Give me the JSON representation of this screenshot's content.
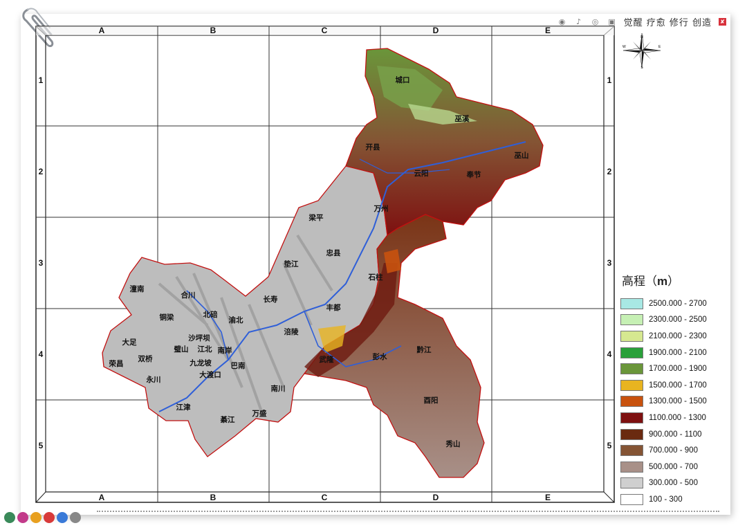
{
  "toolbar": {
    "icons": [
      "wechat-icon",
      "tiktok-icon",
      "weibo-icon",
      "tv-icon"
    ],
    "tagline": "觉醒 疗愈 修行 创造"
  },
  "grid": {
    "columns": [
      "A",
      "B",
      "C",
      "D",
      "E"
    ],
    "rows": [
      "1",
      "2",
      "3",
      "4",
      "5"
    ]
  },
  "compass": {
    "n": "N",
    "s": "S",
    "e": "E",
    "w": "W"
  },
  "places": [
    {
      "name": "城口"
    },
    {
      "name": "巫溪"
    },
    {
      "name": "开县"
    },
    {
      "name": "云阳"
    },
    {
      "name": "奉节"
    },
    {
      "name": "巫山"
    },
    {
      "name": "万州"
    },
    {
      "name": "梁平"
    },
    {
      "name": "忠县"
    },
    {
      "name": "垫江"
    },
    {
      "name": "石柱"
    },
    {
      "name": "潼南"
    },
    {
      "name": "合川"
    },
    {
      "name": "长寿"
    },
    {
      "name": "丰都"
    },
    {
      "name": "铜梁"
    },
    {
      "name": "北碚"
    },
    {
      "name": "渝北"
    },
    {
      "name": "大足"
    },
    {
      "name": "沙坪坝"
    },
    {
      "name": "江北"
    },
    {
      "name": "涪陵"
    },
    {
      "name": "双桥"
    },
    {
      "name": "璧山"
    },
    {
      "name": "九龙坡"
    },
    {
      "name": "南岸"
    },
    {
      "name": "武隆"
    },
    {
      "name": "彭水"
    },
    {
      "name": "黔江"
    },
    {
      "name": "荣昌"
    },
    {
      "name": "永川"
    },
    {
      "name": "大渡口"
    },
    {
      "name": "巴南"
    },
    {
      "name": "南川"
    },
    {
      "name": "江津"
    },
    {
      "name": "酉阳"
    },
    {
      "name": "綦江"
    },
    {
      "name": "万盛"
    },
    {
      "name": "秀山"
    }
  ],
  "legend": {
    "title": "高程",
    "unit": "m",
    "items": [
      {
        "label": "2500.000 - 2700",
        "color": "#a8e8e4"
      },
      {
        "label": "2300.000 - 2500",
        "color": "#c6f0b4"
      },
      {
        "label": "2100.000 - 2300",
        "color": "#d6e890"
      },
      {
        "label": "1900.000 - 2100",
        "color": "#2aa03a"
      },
      {
        "label": "1700.000 - 1900",
        "color": "#6a963a"
      },
      {
        "label": "1500.000 - 1700",
        "color": "#e8b420"
      },
      {
        "label": "1300.000 - 1500",
        "color": "#c8520e"
      },
      {
        "label": "1100.000 - 1300",
        "color": "#7e1010"
      },
      {
        "label": "900.000 - 1100",
        "color": "#6a2a10"
      },
      {
        "label": "700.000 - 900",
        "color": "#845434"
      },
      {
        "label": "500.000 - 700",
        "color": "#a89088"
      },
      {
        "label": "300.000 - 500",
        "color": "#cfcfcf"
      },
      {
        "label": "100 - 300",
        "color": "#ffffff"
      }
    ]
  }
}
